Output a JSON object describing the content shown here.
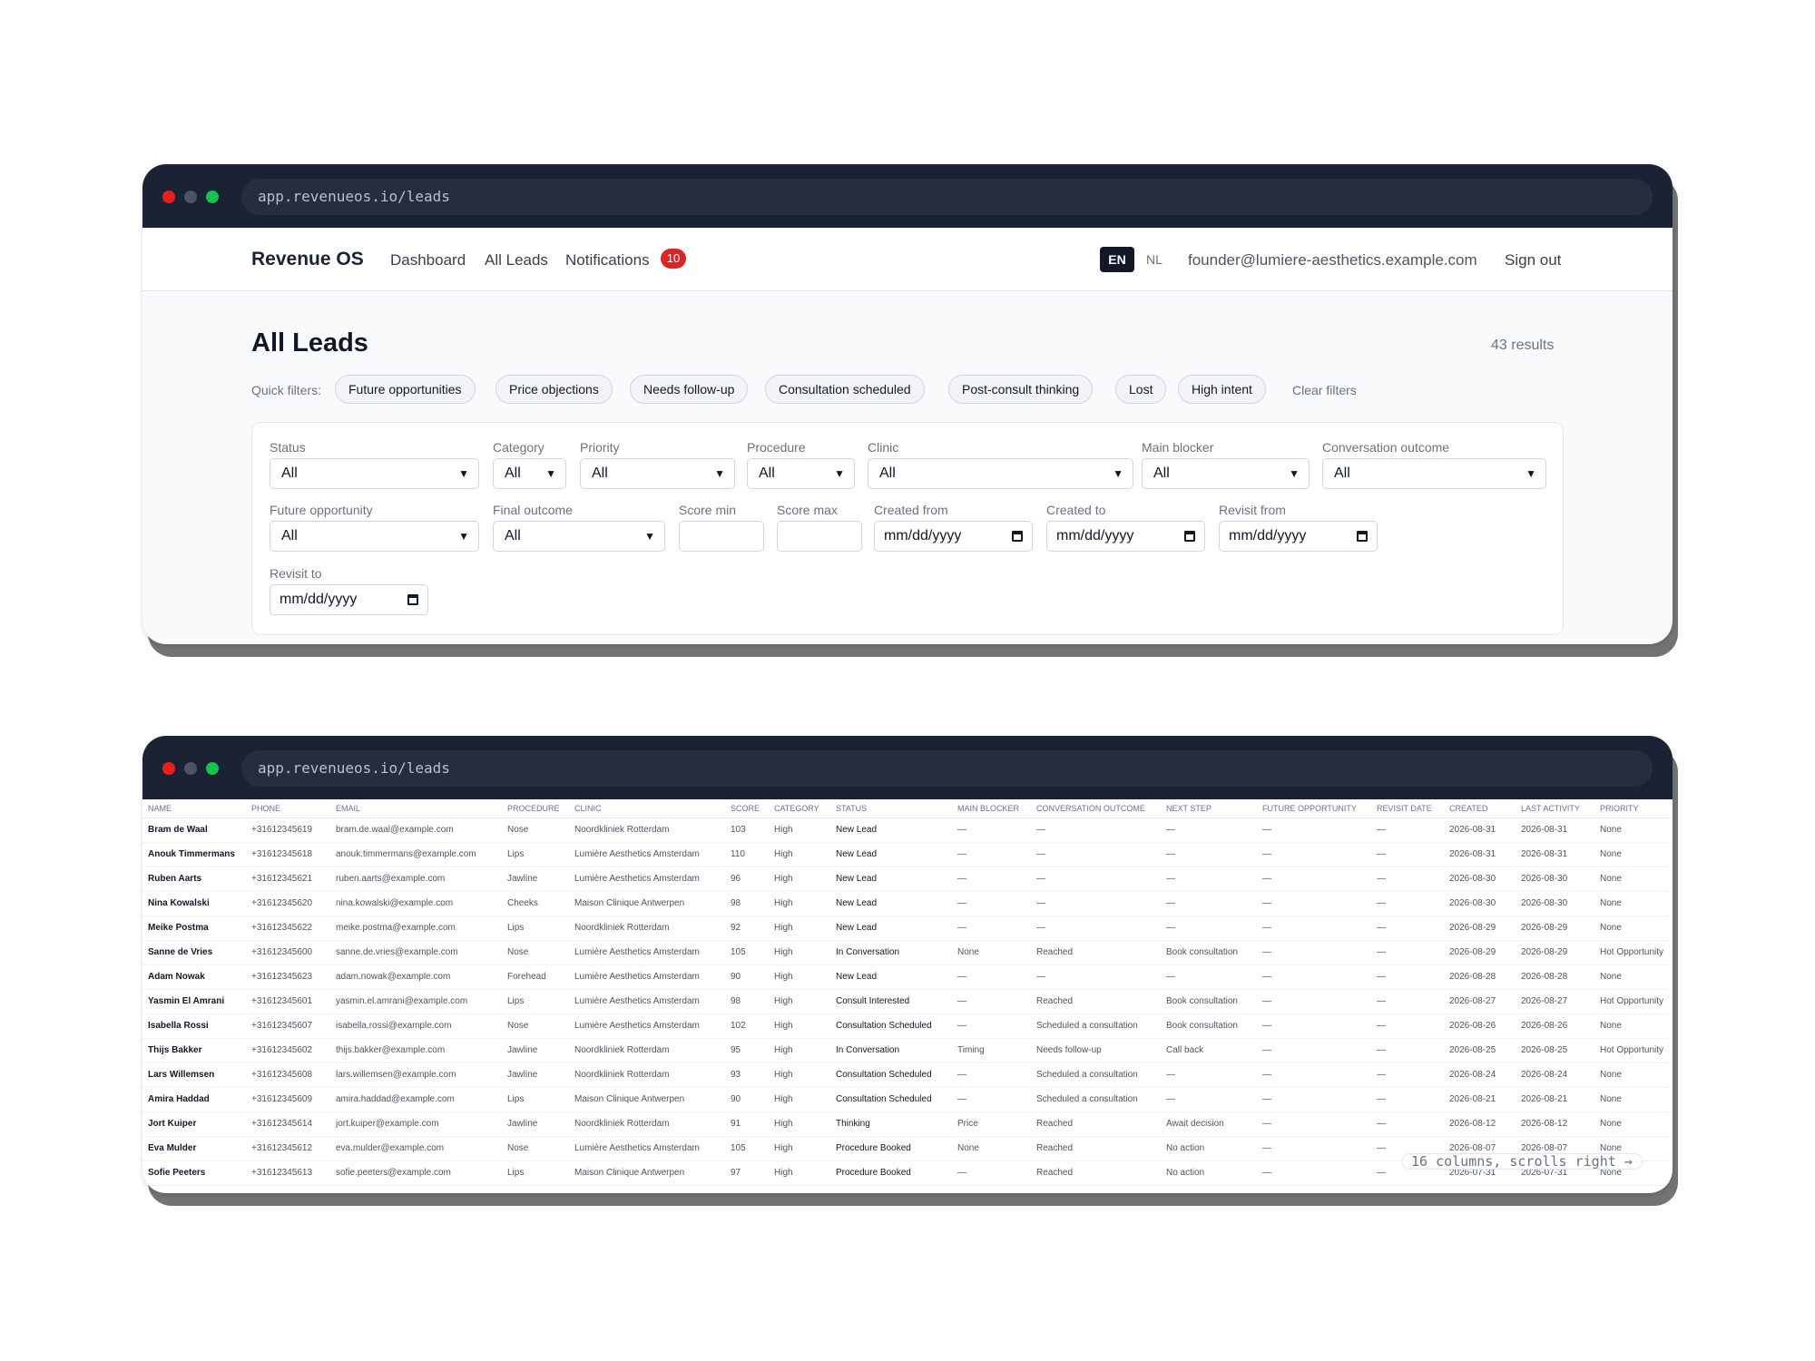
{
  "window1": {
    "url": "app.revenueos.io/leads",
    "nav": {
      "brand": "Revenue OS",
      "dashboard": "Dashboard",
      "all_leads": "All Leads",
      "notifications": "Notifications",
      "notifications_count": "10",
      "lang_active": "EN",
      "lang_other": "NL",
      "user_email": "founder@lumiere-aesthetics.example.com",
      "sign_out": "Sign out"
    },
    "page": {
      "title": "All Leads",
      "results": "43 results",
      "quick_filters_label": "Quick filters:",
      "quick_filters": [
        "Future opportunities",
        "Price objections",
        "Needs follow-up",
        "Consultation scheduled",
        "Post-consult thinking",
        "Lost",
        "High intent"
      ],
      "clear_filters": "Clear filters"
    },
    "filters": {
      "status": {
        "label": "Status",
        "value": "All"
      },
      "category": {
        "label": "Category",
        "value": "All"
      },
      "priority": {
        "label": "Priority",
        "value": "All"
      },
      "procedure": {
        "label": "Procedure",
        "value": "All"
      },
      "clinic": {
        "label": "Clinic",
        "value": "All"
      },
      "main_blocker": {
        "label": "Main blocker",
        "value": "All"
      },
      "conversation_outcome": {
        "label": "Conversation outcome",
        "value": "All"
      },
      "future_opportunity": {
        "label": "Future opportunity",
        "value": "All"
      },
      "final_outcome": {
        "label": "Final outcome",
        "value": "All"
      },
      "score_min": {
        "label": "Score min"
      },
      "score_max": {
        "label": "Score max"
      },
      "created_from": {
        "label": "Created from",
        "placeholder": "mm/dd/yyyy"
      },
      "created_to": {
        "label": "Created to",
        "placeholder": "mm/dd/yyyy"
      },
      "revisit_from": {
        "label": "Revisit from",
        "placeholder": "mm/dd/yyyy"
      },
      "revisit_to": {
        "label": "Revisit to",
        "placeholder": "mm/dd/yyyy"
      }
    }
  },
  "window2": {
    "url": "app.revenueos.io/leads",
    "columns": [
      "Name",
      "Phone",
      "Email",
      "Procedure",
      "Clinic",
      "Score",
      "Category",
      "Status",
      "Main blocker",
      "Conversation outcome",
      "Next step",
      "Future opportunity",
      "Revisit date",
      "Created",
      "Last activity",
      "Priority"
    ],
    "rows": [
      [
        "Bram de Waal",
        "+31612345619",
        "bram.de.waal@example.com",
        "Nose",
        "Noordkliniek Rotterdam",
        "103",
        "High",
        "New Lead",
        "—",
        "—",
        "—",
        "—",
        "—",
        "2026-08-31",
        "2026-08-31",
        "None"
      ],
      [
        "Anouk Timmermans",
        "+31612345618",
        "anouk.timmermans@example.com",
        "Lips",
        "Lumière Aesthetics Amsterdam",
        "110",
        "High",
        "New Lead",
        "—",
        "—",
        "—",
        "—",
        "—",
        "2026-08-31",
        "2026-08-31",
        "None"
      ],
      [
        "Ruben Aarts",
        "+31612345621",
        "ruben.aarts@example.com",
        "Jawline",
        "Lumière Aesthetics Amsterdam",
        "96",
        "High",
        "New Lead",
        "—",
        "—",
        "—",
        "—",
        "—",
        "2026-08-30",
        "2026-08-30",
        "None"
      ],
      [
        "Nina Kowalski",
        "+31612345620",
        "nina.kowalski@example.com",
        "Cheeks",
        "Maison Clinique Antwerpen",
        "98",
        "High",
        "New Lead",
        "—",
        "—",
        "—",
        "—",
        "—",
        "2026-08-30",
        "2026-08-30",
        "None"
      ],
      [
        "Meike Postma",
        "+31612345622",
        "meike.postma@example.com",
        "Lips",
        "Noordkliniek Rotterdam",
        "92",
        "High",
        "New Lead",
        "—",
        "—",
        "—",
        "—",
        "—",
        "2026-08-29",
        "2026-08-29",
        "None"
      ],
      [
        "Sanne de Vries",
        "+31612345600",
        "sanne.de.vries@example.com",
        "Nose",
        "Lumière Aesthetics Amsterdam",
        "105",
        "High",
        "In Conversation",
        "None",
        "Reached",
        "Book consultation",
        "—",
        "—",
        "2026-08-29",
        "2026-08-29",
        "Hot Opportunity"
      ],
      [
        "Adam Nowak",
        "+31612345623",
        "adam.nowak@example.com",
        "Forehead",
        "Lumière Aesthetics Amsterdam",
        "90",
        "High",
        "New Lead",
        "—",
        "—",
        "—",
        "—",
        "—",
        "2026-08-28",
        "2026-08-28",
        "None"
      ],
      [
        "Yasmin El Amrani",
        "+31612345601",
        "yasmin.el.amrani@example.com",
        "Lips",
        "Lumière Aesthetics Amsterdam",
        "98",
        "High",
        "Consult Interested",
        "—",
        "Reached",
        "Book consultation",
        "—",
        "—",
        "2026-08-27",
        "2026-08-27",
        "Hot Opportunity"
      ],
      [
        "Isabella Rossi",
        "+31612345607",
        "isabella.rossi@example.com",
        "Nose",
        "Lumière Aesthetics Amsterdam",
        "102",
        "High",
        "Consultation Scheduled",
        "—",
        "Scheduled a consultation",
        "Book consultation",
        "—",
        "—",
        "2026-08-26",
        "2026-08-26",
        "None"
      ],
      [
        "Thijs Bakker",
        "+31612345602",
        "thijs.bakker@example.com",
        "Jawline",
        "Noordkliniek Rotterdam",
        "95",
        "High",
        "In Conversation",
        "Timing",
        "Needs follow-up",
        "Call back",
        "—",
        "—",
        "2026-08-25",
        "2026-08-25",
        "Hot Opportunity"
      ],
      [
        "Lars Willemsen",
        "+31612345608",
        "lars.willemsen@example.com",
        "Jawline",
        "Noordkliniek Rotterdam",
        "93",
        "High",
        "Consultation Scheduled",
        "—",
        "Scheduled a consultation",
        "—",
        "—",
        "—",
        "2026-08-24",
        "2026-08-24",
        "None"
      ],
      [
        "Amira Haddad",
        "+31612345609",
        "amira.haddad@example.com",
        "Lips",
        "Maison Clinique Antwerpen",
        "90",
        "High",
        "Consultation Scheduled",
        "—",
        "Scheduled a consultation",
        "—",
        "—",
        "—",
        "2026-08-21",
        "2026-08-21",
        "None"
      ],
      [
        "Jort Kuiper",
        "+31612345614",
        "jort.kuiper@example.com",
        "Jawline",
        "Noordkliniek Rotterdam",
        "91",
        "High",
        "Thinking",
        "Price",
        "Reached",
        "Await decision",
        "—",
        "—",
        "2026-08-12",
        "2026-08-12",
        "None"
      ],
      [
        "Eva Mulder",
        "+31612345612",
        "eva.mulder@example.com",
        "Nose",
        "Lumière Aesthetics Amsterdam",
        "105",
        "High",
        "Procedure Booked",
        "None",
        "Reached",
        "No action",
        "—",
        "—",
        "2026-08-07",
        "2026-08-07",
        "None"
      ],
      [
        "Sofie Peeters",
        "+31612345613",
        "sofie.peeters@example.com",
        "Lips",
        "Maison Clinique Antwerpen",
        "97",
        "High",
        "Procedure Booked",
        "—",
        "Reached",
        "No action",
        "—",
        "—",
        "2026-07-31",
        "2026-07-31",
        "None"
      ]
    ],
    "scroll_hint": "16 columns, scrolls right →"
  }
}
